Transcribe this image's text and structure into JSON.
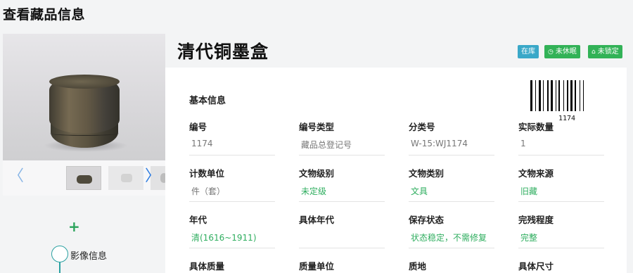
{
  "page": {
    "title": "查看藏品信息"
  },
  "object": {
    "name": "清代铜墨盒",
    "barcode": "1174",
    "badges": {
      "stock": "在库",
      "sleep": "未休眠",
      "lock": "未锁定"
    }
  },
  "section": {
    "basic": "基本信息"
  },
  "fields": [
    {
      "label": "编号",
      "value": "1174",
      "highlight": false
    },
    {
      "label": "编号类型",
      "value": "藏品总登记号",
      "highlight": false
    },
    {
      "label": "分类号",
      "value": "W-15:WJ1174",
      "highlight": false
    },
    {
      "label": "实际数量",
      "value": "1",
      "highlight": false
    },
    {
      "label": "计数单位",
      "value": "件（套）",
      "highlight": false
    },
    {
      "label": "文物级别",
      "value": "未定级",
      "highlight": true
    },
    {
      "label": "文物类别",
      "value": "文具",
      "highlight": true
    },
    {
      "label": "文物来源",
      "value": "旧藏",
      "highlight": true
    },
    {
      "label": "年代",
      "value": "清(1616~1911)",
      "highlight": true
    },
    {
      "label": "具体年代",
      "value": "",
      "highlight": false
    },
    {
      "label": "保存状态",
      "value": "状态稳定，不需修复",
      "highlight": true
    },
    {
      "label": "完残程度",
      "value": "完整",
      "highlight": true
    },
    {
      "label": "具体质量",
      "value": "",
      "highlight": false
    },
    {
      "label": "质量单位",
      "value": "",
      "highlight": false
    },
    {
      "label": "质地",
      "value": "",
      "highlight": false
    },
    {
      "label": "具体尺寸",
      "value": "",
      "highlight": false
    }
  ],
  "sidebar": {
    "media_label": "影像信息"
  },
  "colors": {
    "accent_green": "#2fae5f",
    "badge_blue": "#3aa8c8",
    "badge_green": "#32b257",
    "timeline": "#2aa1a1"
  },
  "icons": {
    "prev": "chevron-left-icon",
    "next": "chevron-right-icon",
    "add": "plus-icon",
    "clock": "clock-icon",
    "lock": "lock-icon"
  }
}
